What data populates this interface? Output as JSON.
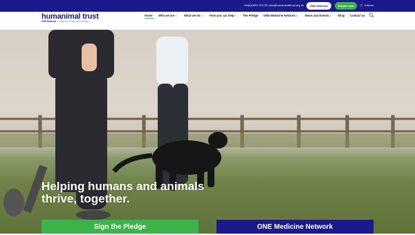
{
  "topbar": {
    "phone": "+44(0)1603 791725",
    "email": "info@humanimaltrust.org.uk",
    "one_medicine_button": "ONE Medicine",
    "donate_button": "Donate now",
    "cart_label": "0 Items"
  },
  "logo": {
    "wordmark": "humanimal trust",
    "tagline_strong": "ONE Medicine",
    "tagline_rest": " - caring for humans and animals"
  },
  "nav": {
    "items": [
      {
        "label": "Home"
      },
      {
        "label": "Who we are"
      },
      {
        "label": "What we do"
      },
      {
        "label": "How you can help"
      },
      {
        "label": "The Pledge"
      },
      {
        "label": "ONE Medicine Network"
      },
      {
        "label": "News and Events"
      },
      {
        "label": "Shop"
      },
      {
        "label": "Contact us"
      }
    ]
  },
  "hero": {
    "headline_line1": "Helping humans and animals",
    "headline_line2": "thrive, together."
  },
  "cta": {
    "pledge": "Sign the Pledge",
    "network": "ONE Medicine Network"
  },
  "colors": {
    "brand_navy": "#1a1a8c",
    "brand_green": "#3cb44b"
  },
  "icons": [
    "cart-icon",
    "search-icon",
    "chevron-down-icon"
  ]
}
